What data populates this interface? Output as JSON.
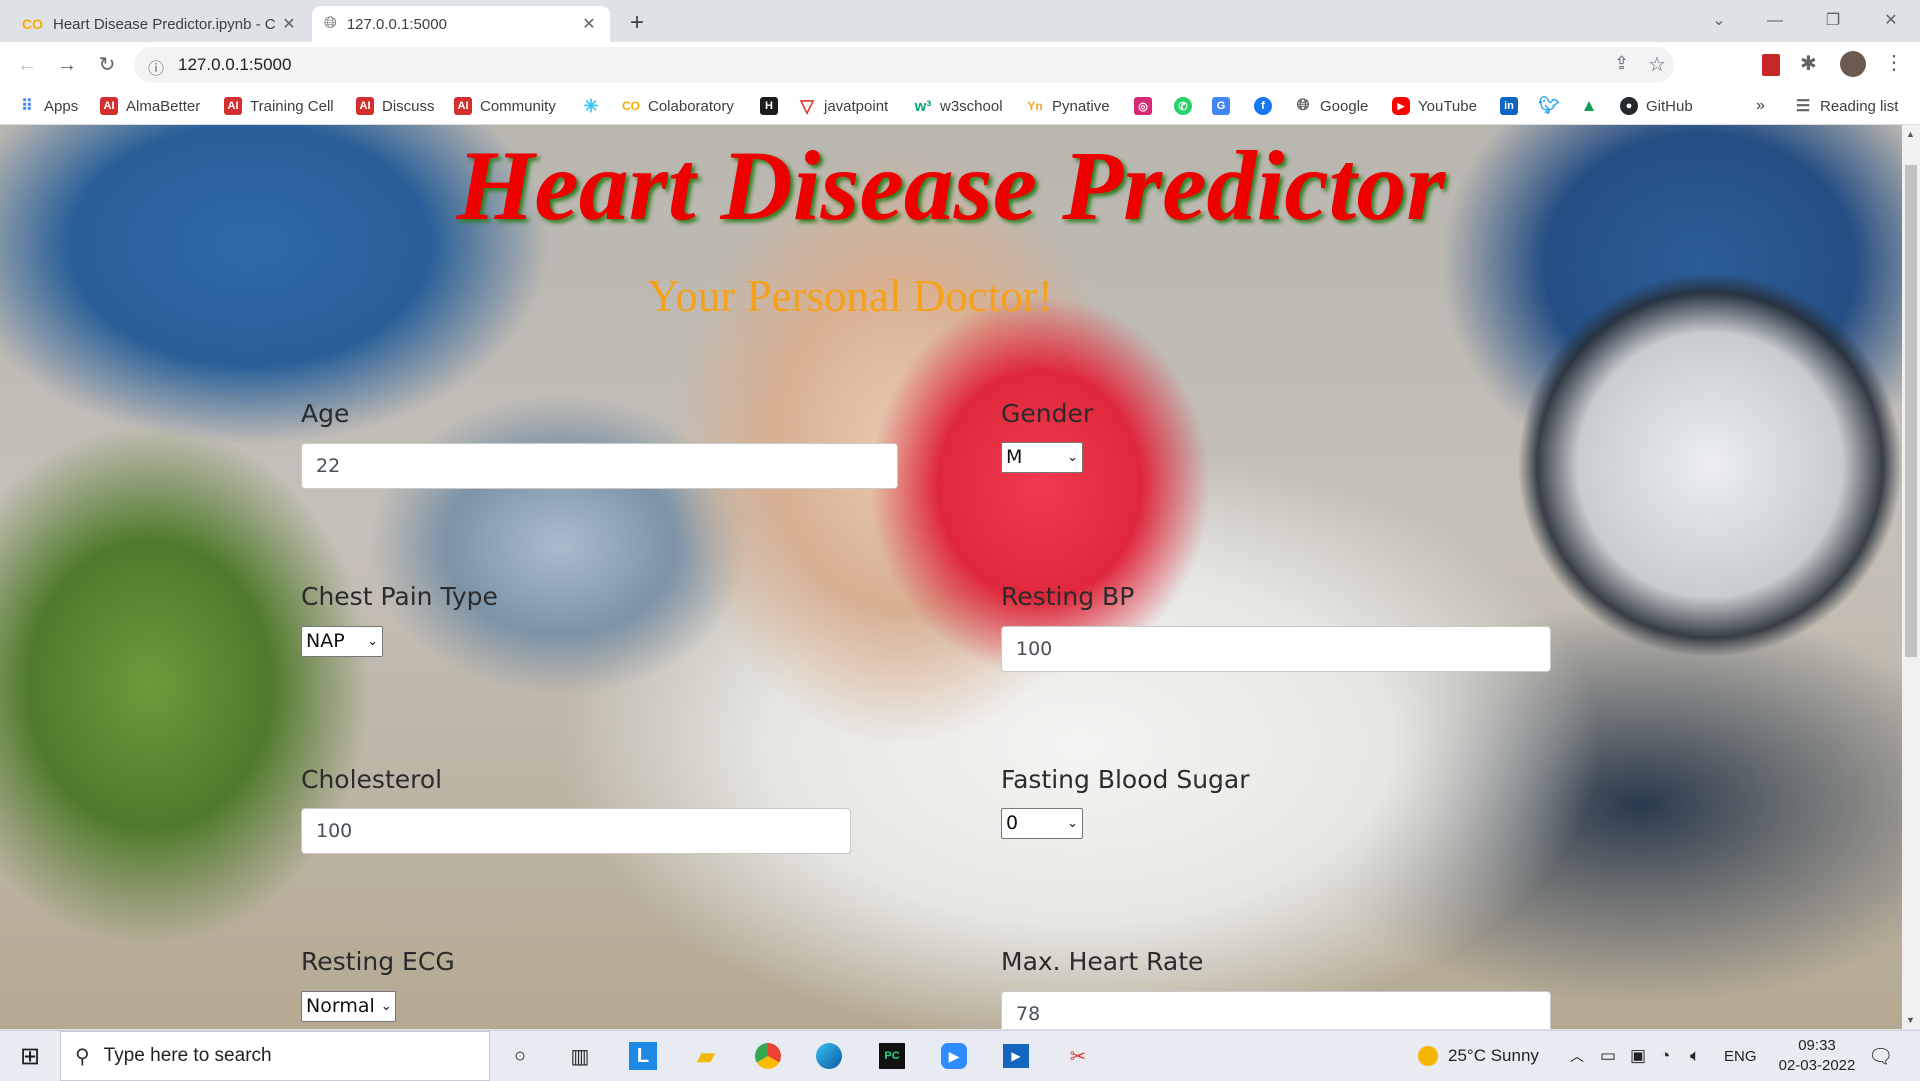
{
  "browser": {
    "tabs": [
      {
        "title": "Heart Disease Predictor.ipynb - C",
        "icon": "colab-icon",
        "active": false
      },
      {
        "title": "127.0.0.1:5000",
        "icon": "globe-icon",
        "active": true
      }
    ],
    "new_tab": "+",
    "url": "127.0.0.1:5000"
  },
  "bookmarks": [
    {
      "label": "Apps",
      "icon": "apps-grid-icon",
      "color": "#4285f4"
    },
    {
      "label": "AlmaBetter",
      "icon": "almabetter-icon",
      "color": "#d32f2f"
    },
    {
      "label": "Training Cell",
      "icon": "almabetter-icon",
      "color": "#d32f2f"
    },
    {
      "label": "Discuss",
      "icon": "almabetter-icon",
      "color": "#d32f2f"
    },
    {
      "label": "Community",
      "icon": "almabetter-icon",
      "color": "#d32f2f"
    },
    {
      "label": "",
      "icon": "slack-icon",
      "color": "#36c5f0"
    },
    {
      "label": "Colaboratory",
      "icon": "colab-icon",
      "color": "#f9ab00"
    },
    {
      "label": "",
      "icon": "hackerrank-icon",
      "color": "#1b1b1b"
    },
    {
      "label": "javatpoint",
      "icon": "javatpoint-icon",
      "color": "#e53935"
    },
    {
      "label": "w3school",
      "icon": "w3schools-icon",
      "color": "#04aa6d"
    },
    {
      "label": "Pynative",
      "icon": "pynative-icon",
      "color": "#f5a623"
    },
    {
      "label": "",
      "icon": "instagram-icon",
      "color": "#d62976"
    },
    {
      "label": "",
      "icon": "whatsapp-icon",
      "color": "#25d366"
    },
    {
      "label": "",
      "icon": "translate-icon",
      "color": "#4285f4"
    },
    {
      "label": "",
      "icon": "facebook-icon",
      "color": "#1877f2"
    },
    {
      "label": "Google",
      "icon": "globe-icon",
      "color": "#5f6368"
    },
    {
      "label": "YouTube",
      "icon": "youtube-icon",
      "color": "#ff0000"
    },
    {
      "label": "",
      "icon": "linkedin-icon",
      "color": "#0a66c2"
    },
    {
      "label": "",
      "icon": "twitter-icon",
      "color": "#1da1f2"
    },
    {
      "label": "",
      "icon": "drive-icon",
      "color": "#0f9d58"
    },
    {
      "label": "GitHub",
      "icon": "github-icon",
      "color": "#24292e"
    }
  ],
  "reading_list": "Reading list",
  "page": {
    "title": "Heart Disease Predictor",
    "subtitle": "Your Personal Doctor!",
    "fields": {
      "age": {
        "label": "Age",
        "value": "22"
      },
      "gender": {
        "label": "Gender",
        "value": "M"
      },
      "chest_pain": {
        "label": "Chest Pain Type",
        "value": "NAP"
      },
      "resting_bp": {
        "label": "Resting BP",
        "value": "100"
      },
      "cholesterol": {
        "label": "Cholesterol",
        "value": "100"
      },
      "fasting_bs": {
        "label": "Fasting Blood Sugar",
        "value": "0"
      },
      "resting_ecg": {
        "label": "Resting ECG",
        "value": "Normal"
      },
      "max_hr": {
        "label": "Max. Heart Rate",
        "value": "78"
      }
    }
  },
  "taskbar": {
    "search_placeholder": "Type here to search",
    "weather": "25°C  Sunny",
    "language": "ENG",
    "time": "09:33",
    "date": "02-03-2022"
  }
}
